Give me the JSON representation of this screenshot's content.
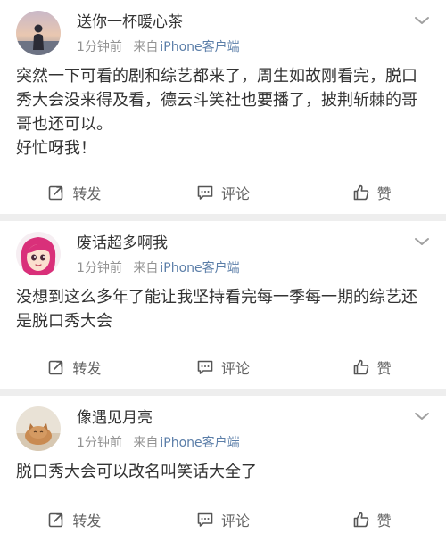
{
  "posts": [
    {
      "username": "送你一杯暖心茶",
      "time": "1分钟前",
      "source_prefix": "来自",
      "source": "iPhone客户端",
      "content": "突然一下可看的剧和综艺都来了，周生如故刚看完，脱口秀大会没来得及看，德云斗笑社也要播了，披荆斩棘的哥哥也还可以。\n好忙呀我！",
      "avatar_icon": "person-silhouette-sunset-avatar",
      "actions": {
        "repost": "转发",
        "comment": "评论",
        "like": "赞"
      }
    },
    {
      "username": "废话超多啊我",
      "time": "1分钟前",
      "source_prefix": "来自",
      "source": "iPhone客户端",
      "content": "没想到这么多年了能让我坚持看完每一季每一期的综艺还是脱口秀大会",
      "avatar_icon": "cartoon-girl-avatar",
      "actions": {
        "repost": "转发",
        "comment": "评论",
        "like": "赞"
      }
    },
    {
      "username": "像遇见月亮",
      "time": "1分钟前",
      "source_prefix": "来自",
      "source": "iPhone客户端",
      "content": "脱口秀大会可以改名叫笑话大全了",
      "avatar_icon": "cat-photo-avatar",
      "actions": {
        "repost": "转发",
        "comment": "评论",
        "like": "赞"
      }
    }
  ],
  "colors": {
    "name": "#333333",
    "meta": "#939393",
    "source": "#5b7ea8",
    "separator": "#eeeeee",
    "action": "#636363"
  }
}
